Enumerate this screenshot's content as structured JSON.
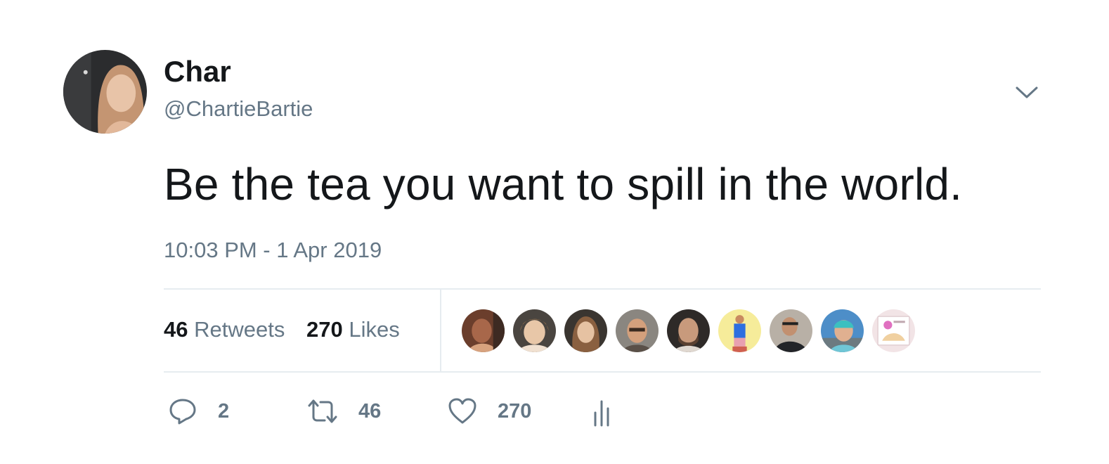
{
  "tweet": {
    "author": {
      "display_name": "Char",
      "handle": "@ChartieBartie"
    },
    "text": "Be the tea you want to spill in the world.",
    "timestamp": "10:03 PM - 1 Apr 2019",
    "stats": {
      "retweets": {
        "count": "46",
        "label": "Retweets"
      },
      "likes": {
        "count": "270",
        "label": "Likes"
      }
    },
    "liker_avatars": [
      "avatar-1",
      "avatar-2",
      "avatar-3",
      "avatar-4",
      "avatar-5",
      "avatar-6",
      "avatar-7",
      "avatar-8",
      "avatar-9"
    ],
    "actions": {
      "reply_count": "2",
      "retweet_count": "46",
      "like_count": "270"
    }
  },
  "icons": {
    "caret": "chevron-down-icon",
    "reply": "reply-icon",
    "retweet": "retweet-icon",
    "like": "heart-icon",
    "analytics": "analytics-icon"
  },
  "colors": {
    "text_primary": "#14171a",
    "text_secondary": "#657786",
    "divider": "#e6ecf0"
  }
}
